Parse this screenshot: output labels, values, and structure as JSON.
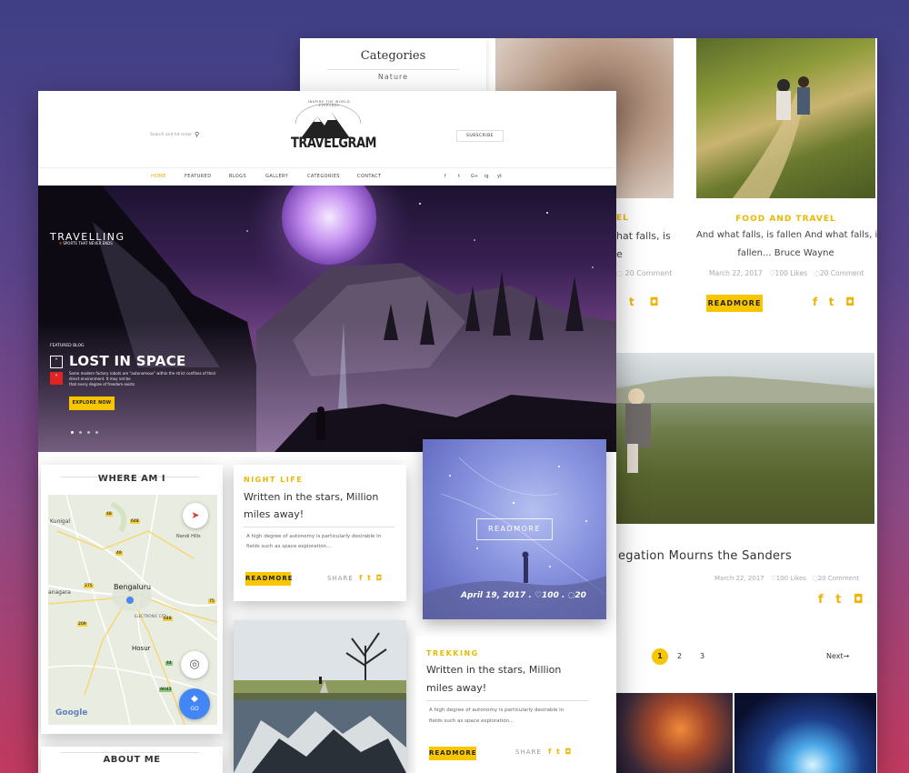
{
  "back_page": {
    "categories_title": "Categories",
    "categories_item": "Nature",
    "post_partial": {
      "category": "EL",
      "excerpt_l1": "hat falls, is",
      "excerpt_l2": "e",
      "comments": "20 Comment"
    },
    "post_food": {
      "category": "FOOD AND TRAVEL",
      "excerpt_l1": "And what falls, is fallen And what falls, is",
      "excerpt_l2": "fallen... Bruce Wayne",
      "date": "March 22, 2017",
      "likes": "100 Likes",
      "comments": "20 Comment",
      "readmore": "READMORE"
    },
    "post_field": {
      "title": "egation Mourns the Sanders",
      "date": "March 22, 2017",
      "likes": "100 Likes",
      "comments": "20 Comment"
    },
    "pagination": {
      "pages": [
        "1",
        "2",
        "3"
      ],
      "next": "Next→"
    }
  },
  "header": {
    "search_placeholder": "Search and hit enter",
    "logo_tagline": "INSPIRE THE WORLD EVERYDAY",
    "logo_text": "TRAVELGRAM",
    "subscribe": "SUBSCRIBE"
  },
  "nav": {
    "items": [
      "HOME",
      "FEATURED",
      "BLOGS",
      "GALLERY",
      "CATEGORIES",
      "CONTACT"
    ],
    "social": [
      "f",
      "t",
      "G+",
      "ig",
      "yt"
    ]
  },
  "hero": {
    "brand_title": "TRAVELLING",
    "brand_sub": "SPORTS THAT NEVER ENDS",
    "featured_label": "FEATURED BLOG",
    "title": "LOST IN SPACE",
    "desc_l1": "Some modern factory robots are \"autonomous\" within the strict confines of their",
    "desc_l2": "direct environment. It may not be",
    "desc_l3": "that every degree of freedom exists",
    "cta": "EXPLORE NOW"
  },
  "sidebar": {
    "where_title": "WHERE AM I",
    "map_labels": {
      "city": "Bengaluru",
      "electronic": "ELECTRONIC CITY",
      "hosur": "Hosur",
      "kunigal": "Kunigal",
      "nandi": "Nandi Hills",
      "anagara": "anagara",
      "n48": "48",
      "n648": "648",
      "n49": "49",
      "n275": "275",
      "n75": "75",
      "n209": "209",
      "n44": "44",
      "nah43": "AH43",
      "google": "Google",
      "go": "GO"
    },
    "about_title": "ABOUT ME"
  },
  "posts": {
    "night": {
      "category": "NIGHT LIFE",
      "title_l1": "Written in the stars, Million",
      "title_l2": "miles away!",
      "excerpt_l1": "A high degree of autonomy is particularly desirable in",
      "excerpt_l2": "fields such as space exploration...",
      "readmore": "READMORE",
      "share": "SHARE"
    },
    "stars_card": {
      "readmore": "READMORE",
      "date": "April 19, 2017",
      "likes": "100",
      "comments": "20"
    },
    "trekking": {
      "category": "TREKKING",
      "title_l1": "Written in the stars, Million",
      "title_l2": "miles away!",
      "excerpt_l1": "A high degree of autonomy is particularly desirable in",
      "excerpt_l2": "fields such as space exploration...",
      "readmore": "READMORE",
      "share": "SHARE"
    }
  },
  "colors": {
    "accent": "#f7c600",
    "accent_text": "#e9b800",
    "nav_active": "#e9a800",
    "hero_red": "#e02424"
  }
}
